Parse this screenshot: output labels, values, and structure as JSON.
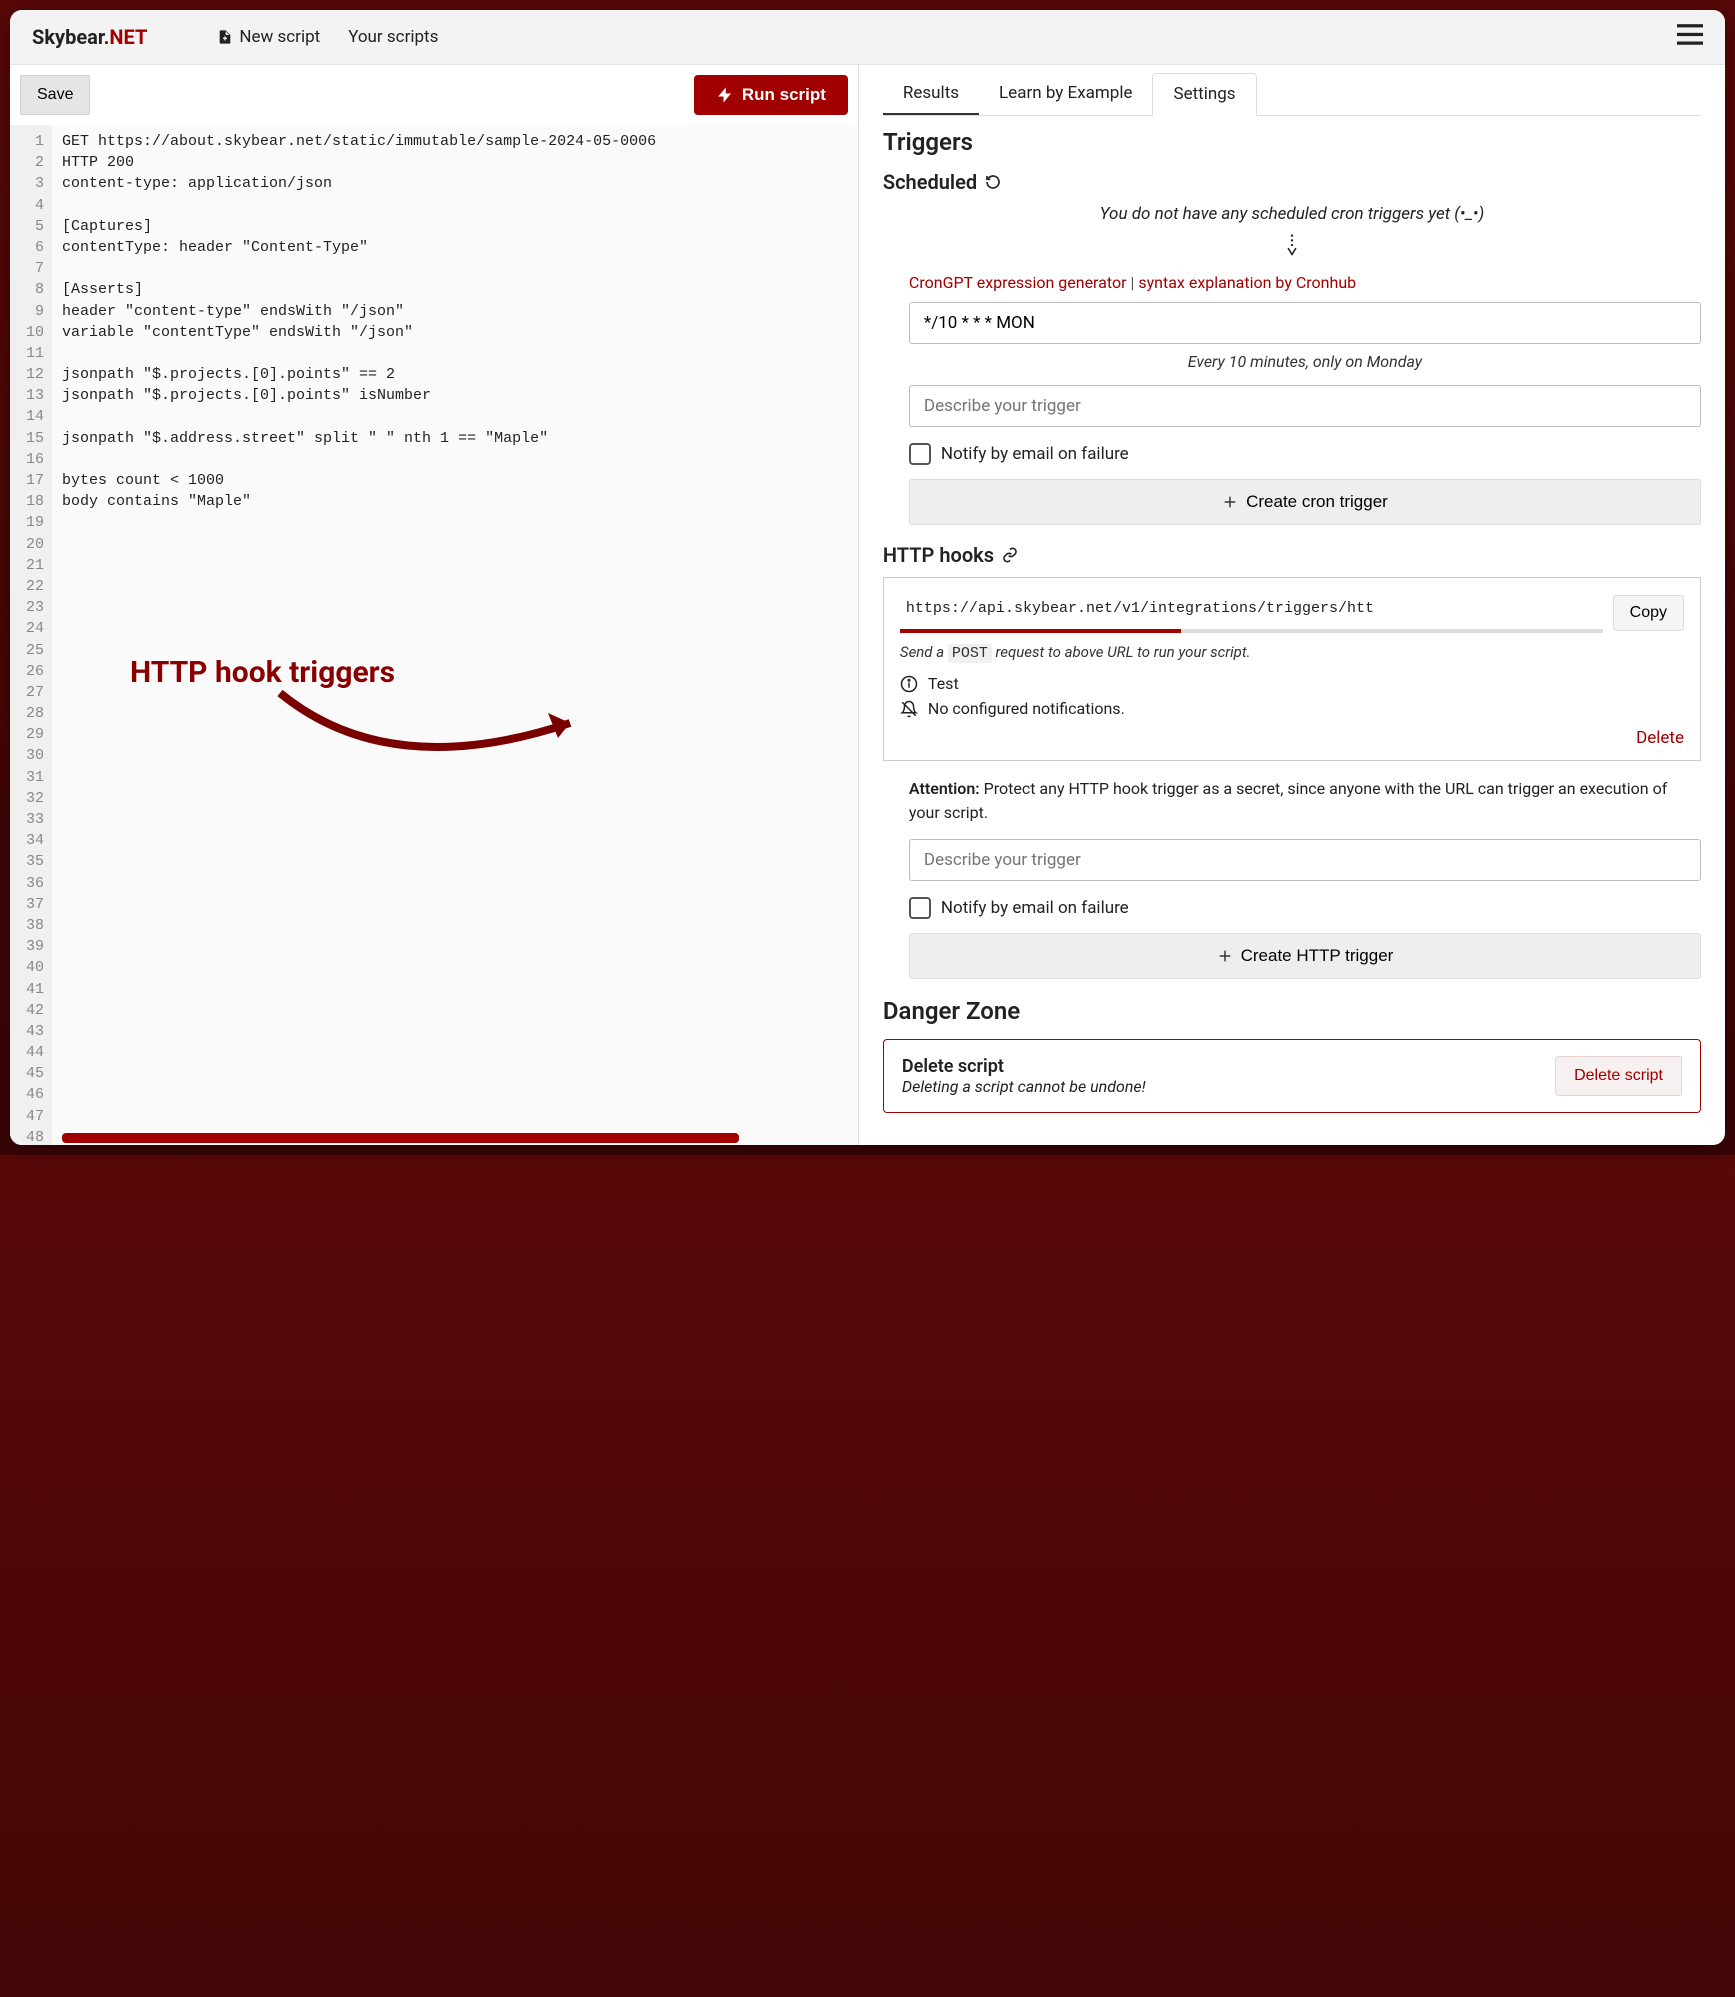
{
  "brand": {
    "part1": "Skybear",
    "part2": ".NET"
  },
  "nav": {
    "new_script": "New script",
    "your_scripts": "Your scripts"
  },
  "toolbar": {
    "save": "Save",
    "run": "Run script"
  },
  "editor": {
    "line_count": 49,
    "lines": [
      "GET https://about.skybear.net/static/immutable/sample-2024-05-0006",
      "HTTP 200",
      "content-type: application/json",
      "",
      "[Captures]",
      "contentType: header \"Content-Type\"",
      "",
      "[Asserts]",
      "header \"content-type\" endsWith \"/json\"",
      "variable \"contentType\" endsWith \"/json\"",
      "",
      "jsonpath \"$.projects.[0].points\" == 2",
      "jsonpath \"$.projects.[0].points\" isNumber",
      "",
      "jsonpath \"$.address.street\" split \" \" nth 1 == \"Maple\"",
      "",
      "bytes count < 1000",
      "body contains \"Maple\""
    ]
  },
  "tabs": {
    "results": "Results",
    "learn": "Learn by Example",
    "settings": "Settings"
  },
  "triggers": {
    "heading": "Triggers",
    "scheduled": {
      "title": "Scheduled",
      "empty_msg": "You do not have any scheduled cron triggers yet (•_•)",
      "link_crongpt": "CronGPT expression generator",
      "link_cronhub": "syntax explanation by Cronhub",
      "cron_value": "*/10 * * * MON",
      "cron_hint": "Every 10 minutes, only on Monday",
      "describe_placeholder": "Describe your trigger",
      "notify_label": "Notify by email on failure",
      "create_label": "Create cron trigger"
    },
    "hooks": {
      "title": "HTTP hooks",
      "url": "https://api.skybear.net/v1/integrations/triggers/htt",
      "copy": "Copy",
      "hint_prefix": "Send a ",
      "hint_code": "POST",
      "hint_suffix": " request to above URL to run your script.",
      "test": "Test",
      "no_notif": "No configured notifications.",
      "delete": "Delete",
      "attention_label": "Attention:",
      "attention_text": " Protect any HTTP hook trigger as a secret, since anyone with the URL can trigger an execution of your script.",
      "describe_placeholder": "Describe your trigger",
      "notify_label": "Notify by email on failure",
      "create_label": "Create HTTP trigger"
    }
  },
  "danger": {
    "heading": "Danger Zone",
    "title": "Delete script",
    "subtitle": "Deleting a script cannot be undone!",
    "button": "Delete script"
  },
  "annotation": {
    "text": "HTTP hook triggers"
  }
}
